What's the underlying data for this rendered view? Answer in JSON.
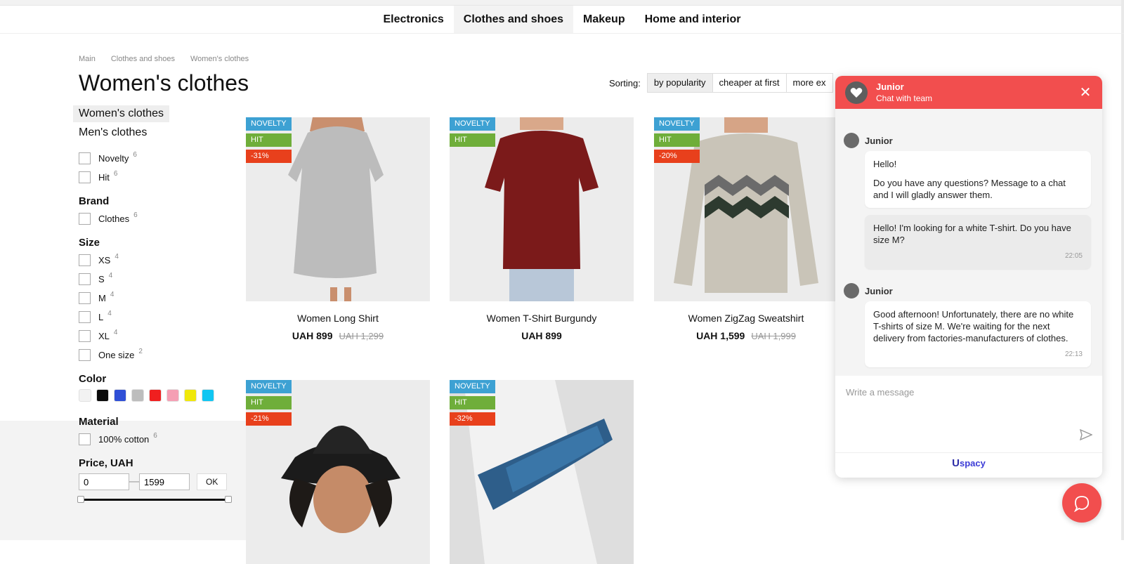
{
  "nav": [
    "Electronics",
    "Clothes and shoes",
    "Makeup",
    "Home and interior"
  ],
  "breadcrumb": [
    "Main",
    "Clothes and shoes",
    "Women's clothes"
  ],
  "page_title": "Women's clothes",
  "sorting": {
    "label": "Sorting:",
    "options": [
      "by popularity",
      "cheaper at first",
      "more ex"
    ]
  },
  "sidebar": {
    "categories": [
      "Women's clothes",
      "Men's clothes"
    ],
    "flags": [
      {
        "label": "Novelty",
        "count": "6"
      },
      {
        "label": "Hit",
        "count": "6"
      }
    ],
    "brand_title": "Brand",
    "brands": [
      {
        "label": "Clothes",
        "count": "6"
      }
    ],
    "size_title": "Size",
    "sizes": [
      {
        "label": "XS",
        "count": "4"
      },
      {
        "label": "S",
        "count": "4"
      },
      {
        "label": "M",
        "count": "4"
      },
      {
        "label": "L",
        "count": "4"
      },
      {
        "label": "XL",
        "count": "4"
      },
      {
        "label": "One size",
        "count": "2"
      }
    ],
    "color_title": "Color",
    "colors": [
      "#f2f2f2",
      "#0a0a0a",
      "#2f4fd6",
      "#bdbdbd",
      "#f01f1f",
      "#f59fb4",
      "#f0e80a",
      "#10c6f2"
    ],
    "material_title": "Material",
    "materials": [
      {
        "label": "100% cotton",
        "count": "6"
      }
    ],
    "price_title": "Price, UAH",
    "price_min": "0",
    "price_max": "1599",
    "ok_label": "OK"
  },
  "products": [
    {
      "name": "Women Long Shirt",
      "price": "UAH 899",
      "old_price": "UAH 1,299",
      "badges": [
        "NOVELTY",
        "HIT",
        "-31%"
      ]
    },
    {
      "name": "Women T-Shirt Burgundy",
      "price": "UAH 899",
      "old_price": "",
      "badges": [
        "NOVELTY",
        "HIT"
      ]
    },
    {
      "name": "Women ZigZag Sweatshirt",
      "price": "UAH 1,599",
      "old_price": "UAH 1,999",
      "badges": [
        "NOVELTY",
        "HIT",
        "-20%"
      ]
    },
    {
      "name": "",
      "price": "",
      "old_price": "",
      "badges": [
        "NOVELTY",
        "HIT",
        "-21%"
      ]
    },
    {
      "name": "",
      "price": "",
      "old_price": "",
      "badges": [
        "NOVELTY",
        "HIT",
        "-32%"
      ]
    }
  ],
  "chat": {
    "title": "Junior",
    "subtitle": "Chat with team",
    "messages": [
      {
        "sender": "Junior",
        "paragraphs": [
          "Hello!",
          "Do you have any questions? Message to a chat and I will gladly answer them."
        ],
        "time": ""
      },
      {
        "sender": "",
        "paragraphs": [
          "Hello! I'm looking for a white T-shirt. Do you have size M?"
        ],
        "time": "22:05"
      },
      {
        "sender": "Junior",
        "paragraphs": [
          "Good afternoon! Unfortunately, there are no white T-shirts of size M. We're waiting for the next delivery from factories-manufacturers of clothes."
        ],
        "time": "22:13"
      }
    ],
    "input_placeholder": "Write a message",
    "brand": "spacy"
  }
}
